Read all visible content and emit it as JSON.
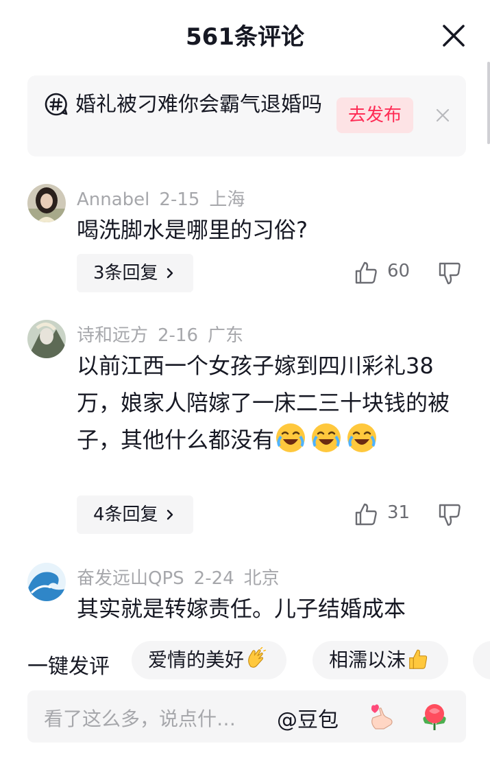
{
  "header": {
    "title": "561条评论"
  },
  "topic": {
    "text": "婚礼被刁难你会霸气退婚吗",
    "publish_label": "去发布"
  },
  "comments": [
    {
      "user": "Annabel",
      "date": "2-15",
      "location": "上海",
      "text": "喝洗脚水是哪里的习俗?",
      "replies_label": "3条回复",
      "likes": "60"
    },
    {
      "user": "诗和远方",
      "date": "2-16",
      "location": "广东",
      "text": "以前江西一个女孩子嫁到四川彩礼38万，娘家人陪嫁了一床二三十块钱的被子，其他什么都没有",
      "emoji": "laughing-crying-emoji",
      "replies_label": "4条回复",
      "likes": "31"
    },
    {
      "user": "奋发远山QPS",
      "date": "2-24",
      "location": "北京",
      "text": "其实就是转嫁责任。儿子结婚成本"
    }
  ],
  "quick_reply": {
    "label": "一键发评",
    "chips": [
      {
        "text": "爱情的美好",
        "emoji": "clapping-hands-emoji"
      },
      {
        "text": "相濡以沫",
        "emoji": "thumbs-up-emoji"
      }
    ]
  },
  "input": {
    "placeholder": "看了这么多，说点什…",
    "mention": "@豆包"
  }
}
